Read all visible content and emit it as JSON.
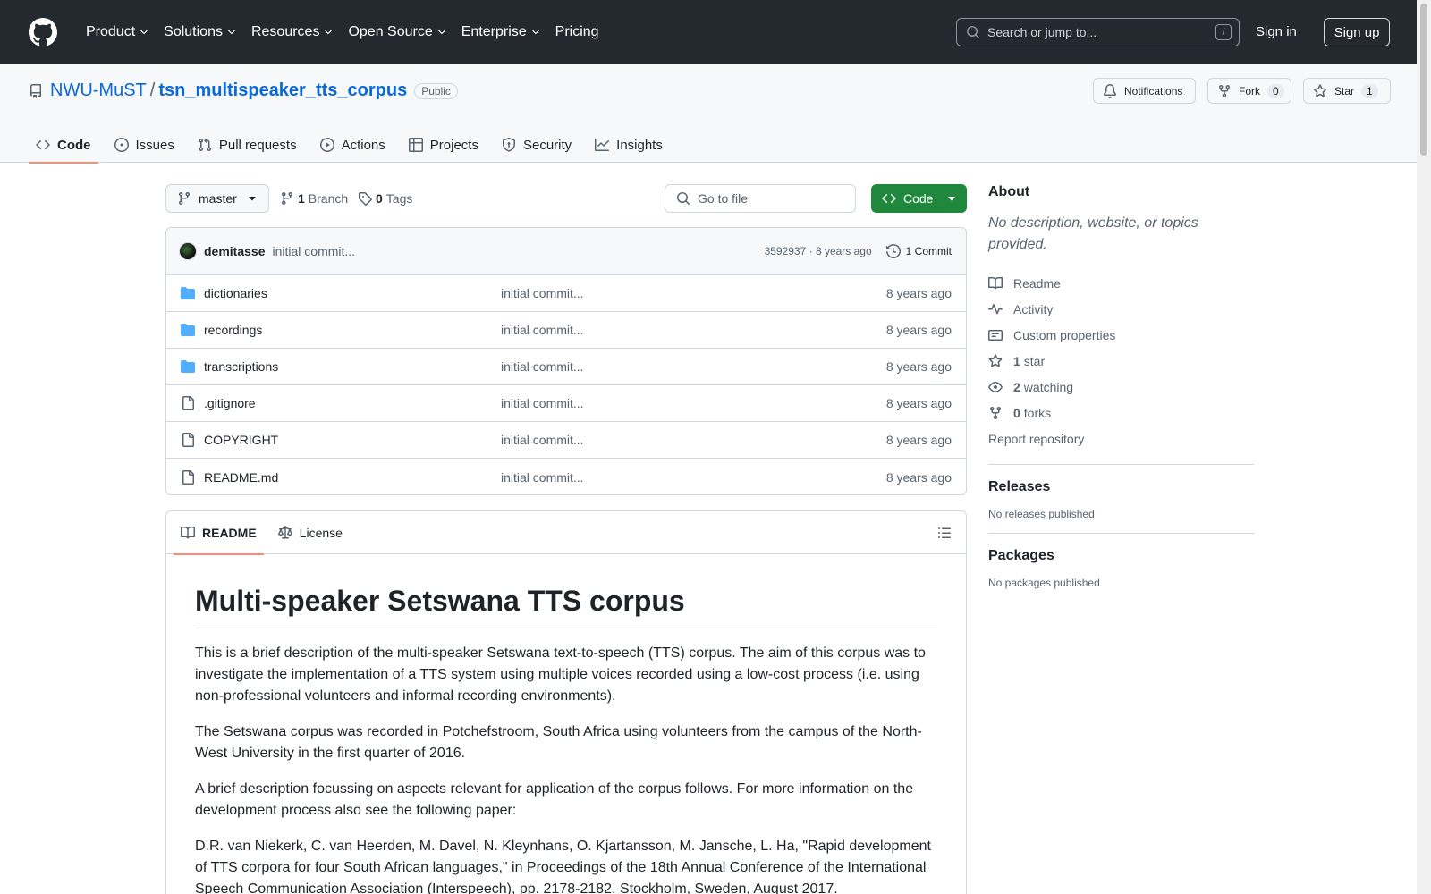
{
  "header": {
    "nav": [
      {
        "label": "Product",
        "dropdown": true
      },
      {
        "label": "Solutions",
        "dropdown": true
      },
      {
        "label": "Resources",
        "dropdown": true
      },
      {
        "label": "Open Source",
        "dropdown": true
      },
      {
        "label": "Enterprise",
        "dropdown": true
      },
      {
        "label": "Pricing",
        "dropdown": false
      }
    ],
    "search_placeholder": "Search or jump to...",
    "search_shortcut": "/",
    "sign_in": "Sign in",
    "sign_up": "Sign up"
  },
  "repo": {
    "owner": "NWU-MuST",
    "separator": "/",
    "name": "tsn_multispeaker_tts_corpus",
    "visibility": "Public",
    "notifications_label": "Notifications",
    "fork_label": "Fork",
    "fork_count": "0",
    "star_label": "Star",
    "star_count": "1"
  },
  "tabs": [
    {
      "label": "Code",
      "icon": "code-icon",
      "selected": true
    },
    {
      "label": "Issues",
      "icon": "issue-icon",
      "selected": false
    },
    {
      "label": "Pull requests",
      "icon": "pull-request-icon",
      "selected": false
    },
    {
      "label": "Actions",
      "icon": "play-icon",
      "selected": false
    },
    {
      "label": "Projects",
      "icon": "table-icon",
      "selected": false
    },
    {
      "label": "Security",
      "icon": "shield-icon",
      "selected": false
    },
    {
      "label": "Insights",
      "icon": "graph-icon",
      "selected": false
    }
  ],
  "toolbar": {
    "branch": "master",
    "branch_count": "1",
    "branch_word": "Branch",
    "tag_count": "0",
    "tag_word": "Tags",
    "goto_placeholder": "Go to file",
    "code_label": "Code"
  },
  "latest_commit": {
    "author": "demitasse",
    "message": "initial commit...",
    "hash_age": "3592937 · 8 years ago",
    "commits_label": "1 Commit"
  },
  "files": [
    {
      "name": "dictionaries",
      "type": "dir",
      "message": "initial commit...",
      "age": "8 years ago"
    },
    {
      "name": "recordings",
      "type": "dir",
      "message": "initial commit...",
      "age": "8 years ago"
    },
    {
      "name": "transcriptions",
      "type": "dir",
      "message": "initial commit...",
      "age": "8 years ago"
    },
    {
      "name": ".gitignore",
      "type": "file",
      "message": "initial commit...",
      "age": "8 years ago"
    },
    {
      "name": "COPYRIGHT",
      "type": "file",
      "message": "initial commit...",
      "age": "8 years ago"
    },
    {
      "name": "README.md",
      "type": "file",
      "message": "initial commit...",
      "age": "8 years ago"
    }
  ],
  "readme": {
    "tab_readme": "README",
    "tab_license": "License",
    "title": "Multi-speaker Setswana TTS corpus",
    "paragraphs": [
      "This is a brief description of the multi-speaker Setswana text-to-speech (TTS) corpus. The aim of this corpus was to investigate the implementation of a TTS system using multiple voices recorded using a low-cost process (i.e. using non-professional volunteers and informal recording environments).",
      "The Setswana corpus was recorded in Potchefstroom, South Africa using volunteers from the campus of the North-West University in the first quarter of 2016.",
      "A brief description focussing on aspects relevant for application of the corpus follows. For more information on the development process also see the following paper:",
      "D.R. van Niekerk, C. van Heerden, M. Davel, N. Kleynhans, O. Kjartansson, M. Jansche, L. Ha, \"Rapid development of TTS corpora for four South African languages,\" in Proceedings of the 18th Annual Conference of the International Speech Communication Association (Interspeech), pp. 2178-2182, Stockholm, Sweden, August 2017."
    ]
  },
  "about": {
    "heading": "About",
    "description": "No description, website, or topics provided.",
    "readme": "Readme",
    "activity": "Activity",
    "custom_properties": "Custom properties",
    "stars_count": "1",
    "stars_word": "star",
    "watching_count": "2",
    "watching_word": "watching",
    "forks_count": "0",
    "forks_word": "forks",
    "report": "Report repository"
  },
  "releases": {
    "heading": "Releases",
    "note": "No releases published"
  },
  "packages": {
    "heading": "Packages",
    "note": "No packages published"
  }
}
